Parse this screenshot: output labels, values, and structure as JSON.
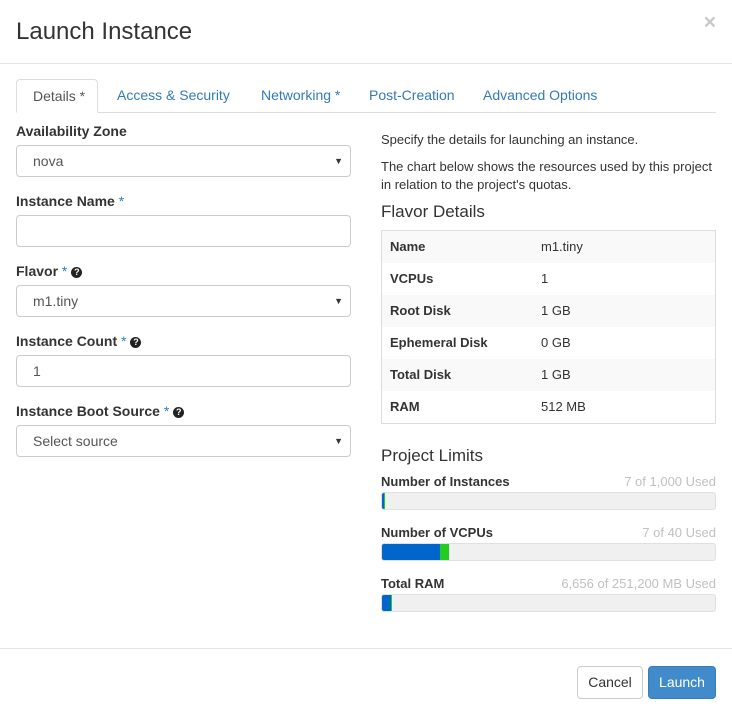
{
  "modal": {
    "title": "Launch Instance",
    "close": "×"
  },
  "tabs": [
    {
      "label": "Details *"
    },
    {
      "label": "Access & Security"
    },
    {
      "label": "Networking *"
    },
    {
      "label": "Post-Creation"
    },
    {
      "label": "Advanced Options"
    }
  ],
  "form": {
    "availability_zone": {
      "label": "Availability Zone",
      "value": "nova"
    },
    "instance_name": {
      "label": "Instance Name",
      "required": "*",
      "value": ""
    },
    "flavor": {
      "label": "Flavor",
      "required": "*",
      "value": "m1.tiny"
    },
    "instance_count": {
      "label": "Instance Count",
      "required": "*",
      "value": "1"
    },
    "boot_source": {
      "label": "Instance Boot Source",
      "required": "*",
      "value": "Select source"
    }
  },
  "info": {
    "description1": "Specify the details for launching an instance.",
    "description2": "The chart below shows the resources used by this project in relation to the project's quotas."
  },
  "flavor_details": {
    "title": "Flavor Details",
    "rows": [
      {
        "key": "Name",
        "value": "m1.tiny"
      },
      {
        "key": "VCPUs",
        "value": "1"
      },
      {
        "key": "Root Disk",
        "value": "1 GB"
      },
      {
        "key": "Ephemeral Disk",
        "value": "0 GB"
      },
      {
        "key": "Total Disk",
        "value": "1 GB"
      },
      {
        "key": "RAM",
        "value": "512 MB"
      }
    ]
  },
  "project_limits": {
    "title": "Project Limits",
    "items": [
      {
        "label": "Number of Instances",
        "used_text": "7 of 1,000 Used",
        "used_fraction": 0.007,
        "added_fraction": 0.001
      },
      {
        "label": "Number of VCPUs",
        "used_text": "7 of 40 Used",
        "used_fraction": 0.175,
        "added_fraction": 0.025
      },
      {
        "label": "Total RAM",
        "used_text": "6,656 of 251,200 MB Used",
        "used_fraction": 0.0265,
        "added_fraction": 0.002
      }
    ]
  },
  "colors": {
    "bar_used": "#0066cc",
    "bar_added": "#22cc22",
    "primary": "#428bca",
    "link": "#337ab7"
  },
  "footer": {
    "cancel_label": "Cancel",
    "launch_label": "Launch"
  }
}
